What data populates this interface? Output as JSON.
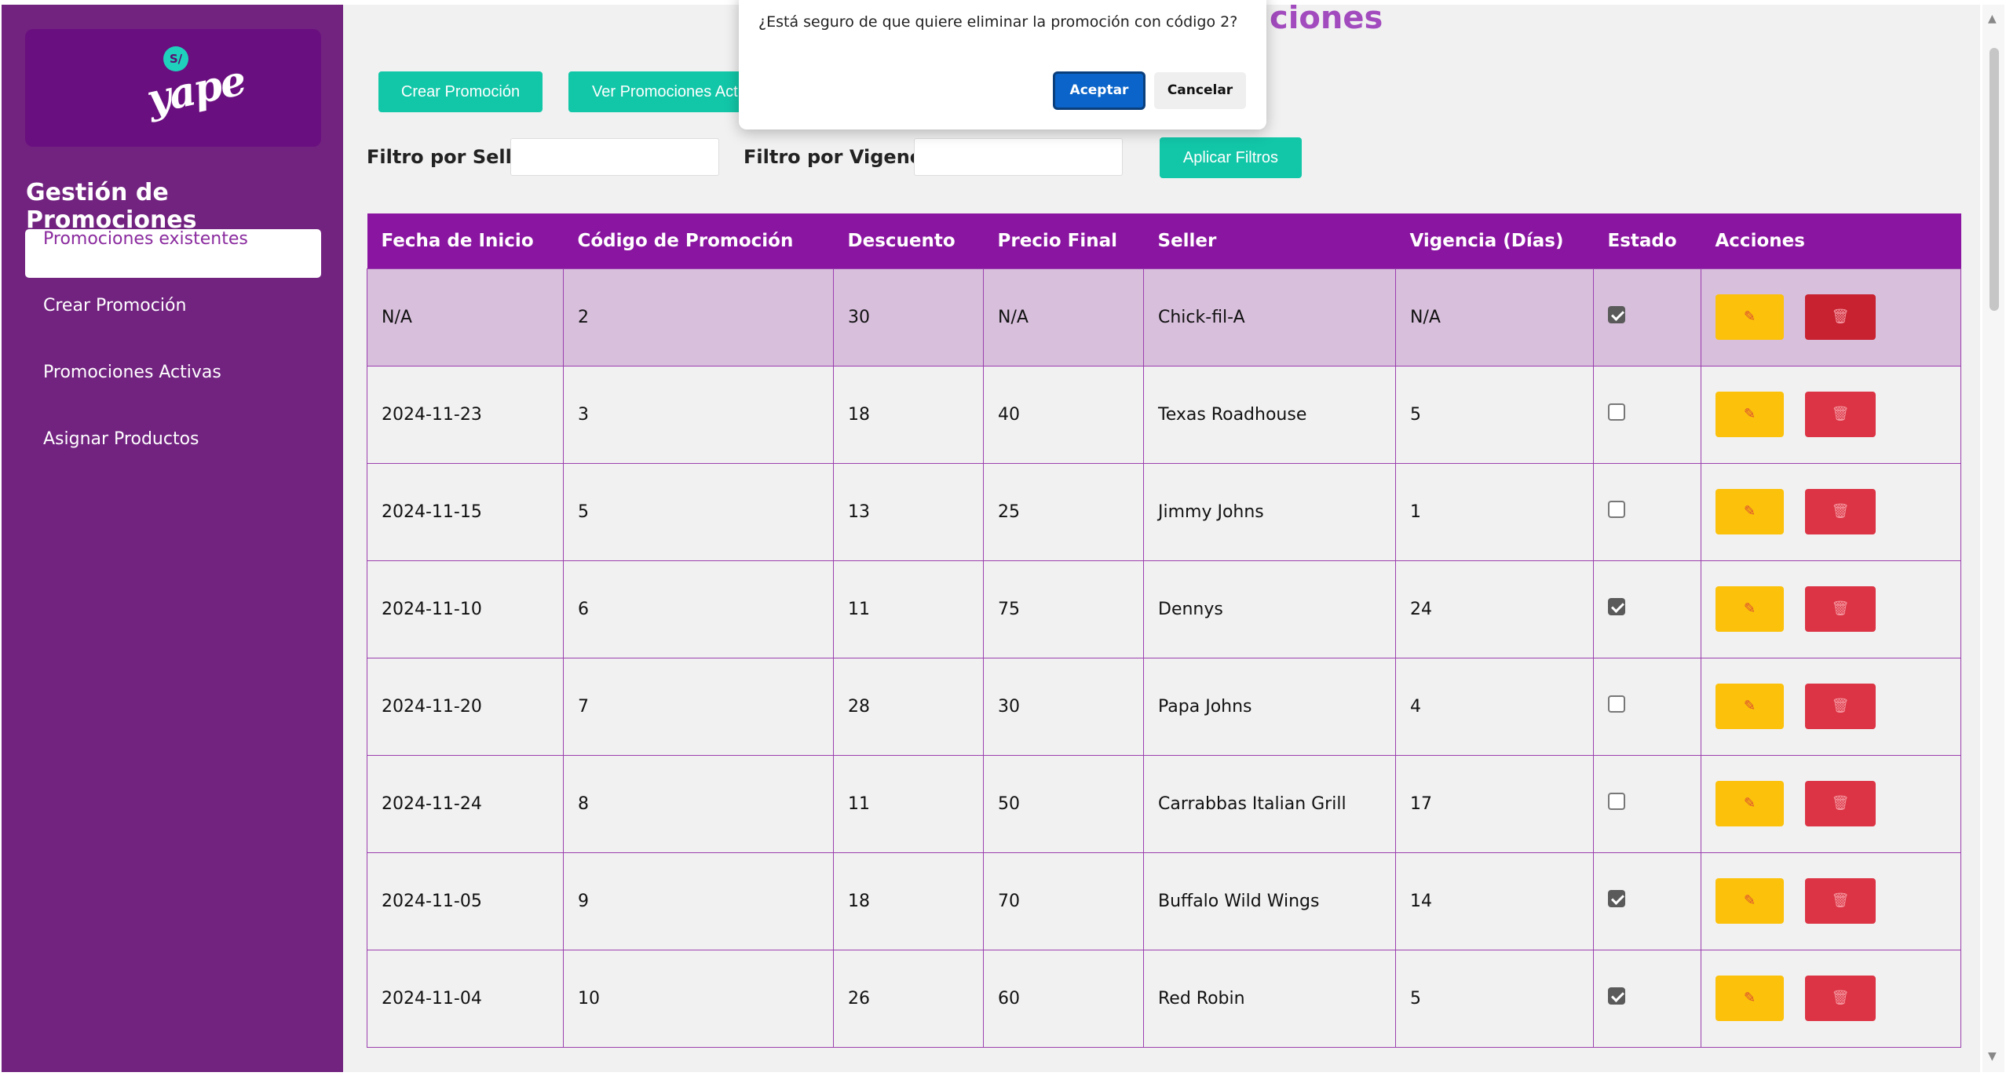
{
  "sidebar": {
    "logo_coin": "S/",
    "logo_text": "yape",
    "title": "Gestión de Promociones",
    "items": [
      {
        "label": "Promociones existentes",
        "active": true
      },
      {
        "label": "Crear Promoción",
        "active": false
      },
      {
        "label": "Promociones Activas",
        "active": false
      },
      {
        "label": "Asignar Productos",
        "active": false
      }
    ]
  },
  "main": {
    "title_fragment": "ciones",
    "buttons": {
      "crear": "Crear Promoción",
      "ver": "Ver Promociones Act",
      "filtros": "Aplicar Filtros"
    },
    "filters": {
      "seller_label": "Filtro por Seller:",
      "vigencia_label": "Filtro por Vigencia:",
      "seller_value": "",
      "vigencia_value": ""
    }
  },
  "table": {
    "headers": [
      "Fecha de Inicio",
      "Código de Promoción",
      "Descuento",
      "Precio Final",
      "Seller",
      "Vigencia (Días)",
      "Estado",
      "Acciones"
    ],
    "rows": [
      {
        "fecha": "N/A",
        "codigo": "2",
        "descuento": "30",
        "precio": "N/A",
        "seller": "Chick-fil-A",
        "vigencia": "N/A",
        "estado": true
      },
      {
        "fecha": "2024-11-23",
        "codigo": "3",
        "descuento": "18",
        "precio": "40",
        "seller": "Texas Roadhouse",
        "vigencia": "5",
        "estado": false
      },
      {
        "fecha": "2024-11-15",
        "codigo": "5",
        "descuento": "13",
        "precio": "25",
        "seller": "Jimmy Johns",
        "vigencia": "1",
        "estado": false
      },
      {
        "fecha": "2024-11-10",
        "codigo": "6",
        "descuento": "11",
        "precio": "75",
        "seller": "Dennys",
        "vigencia": "24",
        "estado": true
      },
      {
        "fecha": "2024-11-20",
        "codigo": "7",
        "descuento": "28",
        "precio": "30",
        "seller": "Papa Johns",
        "vigencia": "4",
        "estado": false
      },
      {
        "fecha": "2024-11-24",
        "codigo": "8",
        "descuento": "11",
        "precio": "50",
        "seller": "Carrabbas Italian Grill",
        "vigencia": "17",
        "estado": false
      },
      {
        "fecha": "2024-11-05",
        "codigo": "9",
        "descuento": "18",
        "precio": "70",
        "seller": "Buffalo Wild Wings",
        "vigencia": "14",
        "estado": true
      },
      {
        "fecha": "2024-11-04",
        "codigo": "10",
        "descuento": "26",
        "precio": "60",
        "seller": "Red Robin",
        "vigencia": "5",
        "estado": true
      }
    ],
    "edit_icon": "pencil-icon",
    "delete_icon": "trash-icon"
  },
  "dialog": {
    "message": "¿Está seguro de que quiere eliminar la promoción con código 2?",
    "ok": "Aceptar",
    "cancel": "Cancelar"
  },
  "colors": {
    "sidebar": "#722380",
    "header": "#8a15a0",
    "teal": "#12c7a8",
    "edit": "#fcc10a",
    "delete": "#dc3444",
    "highlight_row": "#d8bfdc"
  }
}
